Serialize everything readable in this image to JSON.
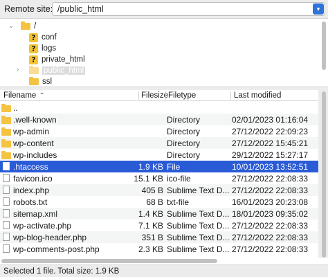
{
  "site_bar": {
    "label": "Remote site:",
    "path": "/public_html"
  },
  "tree": [
    {
      "label": "/",
      "icon": "folder-icon",
      "level": 0,
      "expanded": true,
      "selected": false
    },
    {
      "label": "conf",
      "icon": "unknown-folder-icon",
      "level": 1,
      "selected": false
    },
    {
      "label": "logs",
      "icon": "unknown-folder-icon",
      "level": 1,
      "selected": false
    },
    {
      "label": "private_html",
      "icon": "unknown-folder-icon",
      "level": 1,
      "selected": false
    },
    {
      "label": "public_html",
      "icon": "folder-icon",
      "level": 1,
      "collapsed": true,
      "selected": true
    },
    {
      "label": "ssl",
      "icon": "folder-icon",
      "level": 1,
      "selected": false
    }
  ],
  "list": {
    "headers": {
      "filename": "Filename",
      "filesize": "Filesize",
      "filetype": "Filetype",
      "last_modified": "Last modified"
    },
    "sort_column": "filename",
    "rows": [
      {
        "name": "..",
        "size": "",
        "type": "",
        "modified": "",
        "kind": "folder"
      },
      {
        "name": ".well-known",
        "size": "",
        "type": "Directory",
        "modified": "02/01/2023 01:16:04",
        "kind": "folder"
      },
      {
        "name": "wp-admin",
        "size": "",
        "type": "Directory",
        "modified": "27/12/2022 22:09:23",
        "kind": "folder"
      },
      {
        "name": "wp-content",
        "size": "",
        "type": "Directory",
        "modified": "27/12/2022 15:45:21",
        "kind": "folder"
      },
      {
        "name": "wp-includes",
        "size": "",
        "type": "Directory",
        "modified": "29/12/2022 15:27:17",
        "kind": "folder"
      },
      {
        "name": ".htaccess",
        "size": "1.9 KB",
        "type": "File",
        "modified": "10/01/2023 13:52:51",
        "kind": "file",
        "selected": true
      },
      {
        "name": "favicon.ico",
        "size": "15.1 KB",
        "type": "ico-file",
        "modified": "27/12/2022 22:08:33",
        "kind": "file"
      },
      {
        "name": "index.php",
        "size": "405 B",
        "type": "Sublime Text D...",
        "modified": "27/12/2022 22:08:33",
        "kind": "file"
      },
      {
        "name": "robots.txt",
        "size": "68 B",
        "type": "txt-file",
        "modified": "16/01/2023 20:23:08",
        "kind": "file"
      },
      {
        "name": "sitemap.xml",
        "size": "1.4 KB",
        "type": "Sublime Text D...",
        "modified": "18/01/2023 09:35:02",
        "kind": "file"
      },
      {
        "name": "wp-activate.php",
        "size": "7.1 KB",
        "type": "Sublime Text D...",
        "modified": "27/12/2022 22:08:33",
        "kind": "file"
      },
      {
        "name": "wp-blog-header.php",
        "size": "351 B",
        "type": "Sublime Text D...",
        "modified": "27/12/2022 22:08:33",
        "kind": "file"
      },
      {
        "name": "wp-comments-post.php",
        "size": "2.3 KB",
        "type": "Sublime Text D...",
        "modified": "27/12/2022 22:08:33",
        "kind": "file"
      }
    ]
  },
  "status": {
    "text": "Selected 1 file. Total size: 1.9 KB"
  },
  "colors": {
    "selection": "#2a5bd7",
    "folder": "#f5c342",
    "accent": "#2f73d9"
  }
}
